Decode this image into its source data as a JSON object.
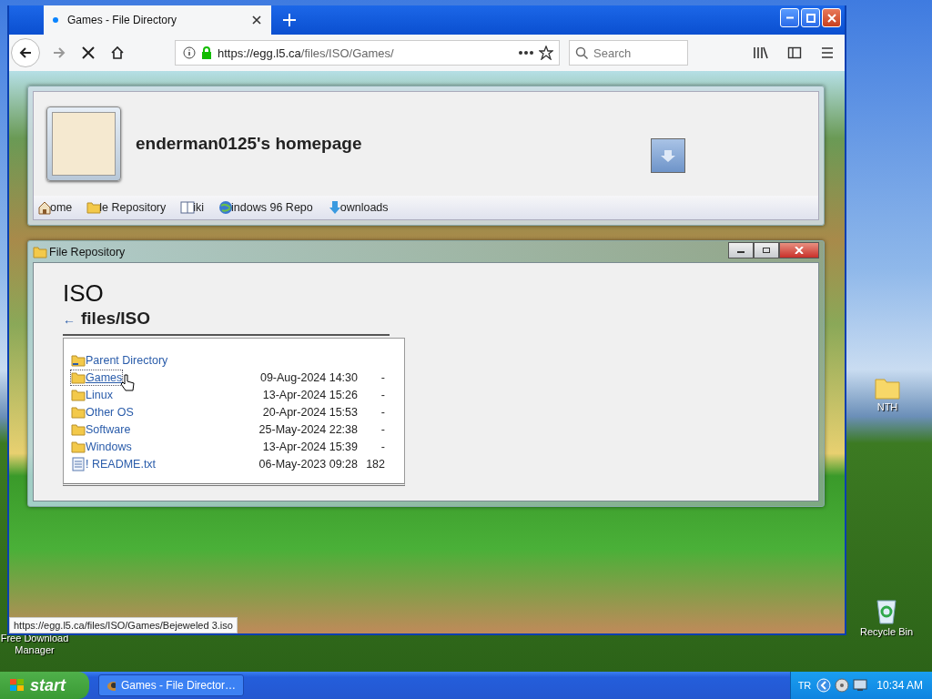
{
  "browser": {
    "tab": {
      "title": "Games - File Directory",
      "selected": true
    },
    "url_host": "https://egg.l5.ca",
    "url_path": "/files/ISO/Games/",
    "search": {
      "placeholder": "Search"
    },
    "status_url": "https://egg.l5.ca/files/ISO/Games/Bejeweled 3.iso"
  },
  "site": {
    "title": "enderman0125's homepage",
    "nav": [
      {
        "label": "ome"
      },
      {
        "label": "le Repository"
      },
      {
        "label": "iki"
      },
      {
        "label": "indows 96 Repo"
      },
      {
        "label": "ownloads"
      }
    ]
  },
  "repo_window": {
    "title": "File Repository",
    "heading": "ISO",
    "path_arrow": "←",
    "path": "files/ISO",
    "entries": [
      {
        "kind": "parent",
        "name": "Parent Directory",
        "focused": false
      },
      {
        "kind": "folder",
        "name": "Games",
        "date": "09-Aug-2024 14:30",
        "size": "-",
        "focused": true
      },
      {
        "kind": "folder",
        "name": "Linux",
        "date": "13-Apr-2024 15:26",
        "size": "-",
        "focused": false
      },
      {
        "kind": "folder",
        "name": "Other OS",
        "date": "20-Apr-2024 15:53",
        "size": "-",
        "focused": false
      },
      {
        "kind": "folder",
        "name": "Software",
        "date": "25-May-2024 22:38",
        "size": "-",
        "focused": false
      },
      {
        "kind": "folder",
        "name": "Windows",
        "date": "13-Apr-2024 15:39",
        "size": "-",
        "focused": false
      },
      {
        "kind": "file",
        "name": "! README.txt",
        "date": "06-May-2023 09:28",
        "size": "182",
        "focused": false
      }
    ]
  },
  "desktop": {
    "icons": [
      {
        "kind": "folder",
        "label": "NTH"
      },
      {
        "kind": "recycle",
        "label": "Recycle Bin"
      },
      {
        "kind": "hidden",
        "label": "Free Download Manager"
      }
    ]
  },
  "taskbar": {
    "start": "start",
    "tasks": [
      {
        "label": "Games - File Director…",
        "selected": false
      }
    ],
    "language": "TR",
    "clock": "10:34 AM"
  }
}
